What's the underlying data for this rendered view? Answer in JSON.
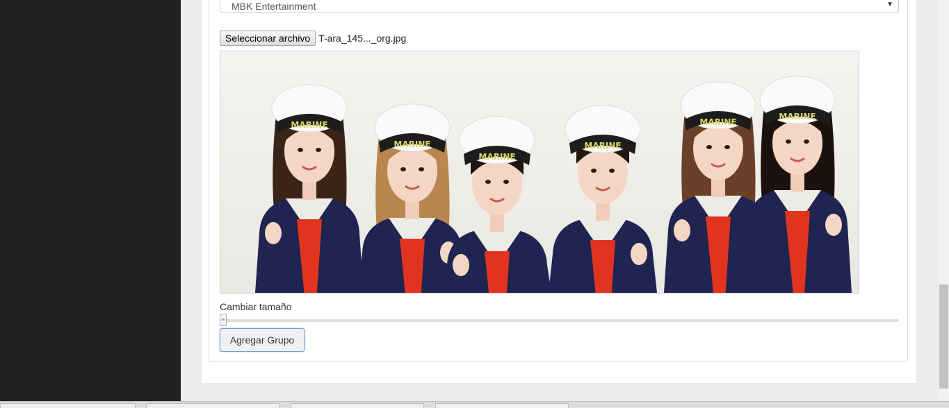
{
  "form": {
    "agency_select_value": "MBK Entertainment",
    "file_button_label": "Seleccionar archivo",
    "file_name": "T-ara_145..._org.jpg",
    "resize_label": "Cambiar tamaño",
    "submit_label": "Agregar Grupo",
    "resize_level": 0,
    "image_caps_text": "MARINE"
  },
  "colors": {
    "sidebar": "#222222",
    "button_focus_border": "#6f9bd6"
  }
}
